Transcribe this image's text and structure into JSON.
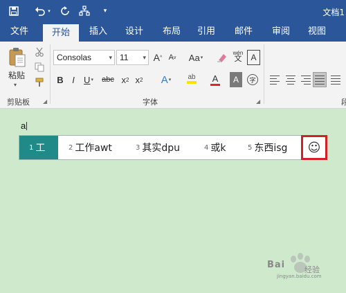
{
  "window": {
    "title": "文档1"
  },
  "qat": {
    "save_icon": "save-icon",
    "undo_icon": "undo-icon",
    "redo_icon": "redo-icon",
    "touch_mode_icon": "touch-mode-icon",
    "customize_icon": "customize-qat-icon"
  },
  "tabs": [
    {
      "label": "文件",
      "active": false
    },
    {
      "label": "开始",
      "active": true
    },
    {
      "label": "插入",
      "active": false
    },
    {
      "label": "设计",
      "active": false
    },
    {
      "label": "布局",
      "active": false
    },
    {
      "label": "引用",
      "active": false
    },
    {
      "label": "邮件",
      "active": false
    },
    {
      "label": "审阅",
      "active": false
    },
    {
      "label": "视图",
      "active": false
    }
  ],
  "ribbon": {
    "clipboard": {
      "paste_label": "粘贴",
      "group_label": "剪贴板"
    },
    "font": {
      "font_name": "Consolas",
      "font_size": "11",
      "grow_label": "A",
      "shrink_label": "A",
      "case_label": "Aa",
      "bold_label": "B",
      "italic_label": "I",
      "underline_label": "U",
      "strike_label": "abc",
      "subscript_label": "x",
      "superscript_label": "x",
      "effects_label": "A",
      "highlight_label": "ab",
      "color_label": "A",
      "shading_label": "A",
      "phonetic_label": "wén",
      "border_char_label": "A",
      "enclose_label": "字",
      "group_label": "字体"
    },
    "paragraph": {
      "group_label": "段"
    }
  },
  "document": {
    "typed_text": "a"
  },
  "ime": {
    "candidates": [
      {
        "num": "1",
        "text": "工"
      },
      {
        "num": "2",
        "text": "工作awt"
      },
      {
        "num": "3",
        "text": "其实dpu"
      },
      {
        "num": "4",
        "text": "或k"
      },
      {
        "num": "5",
        "text": "东西isg"
      }
    ],
    "face_symbol": "☺",
    "highlight_color": "#1f8a87",
    "emphasis_color": "#d32027"
  },
  "watermark": {
    "brand": "Bai",
    "sub": "经验",
    "url": "jingyan.baidu.com"
  },
  "colors": {
    "accent": "#2b579a",
    "page_background": "#cfe9cd"
  }
}
